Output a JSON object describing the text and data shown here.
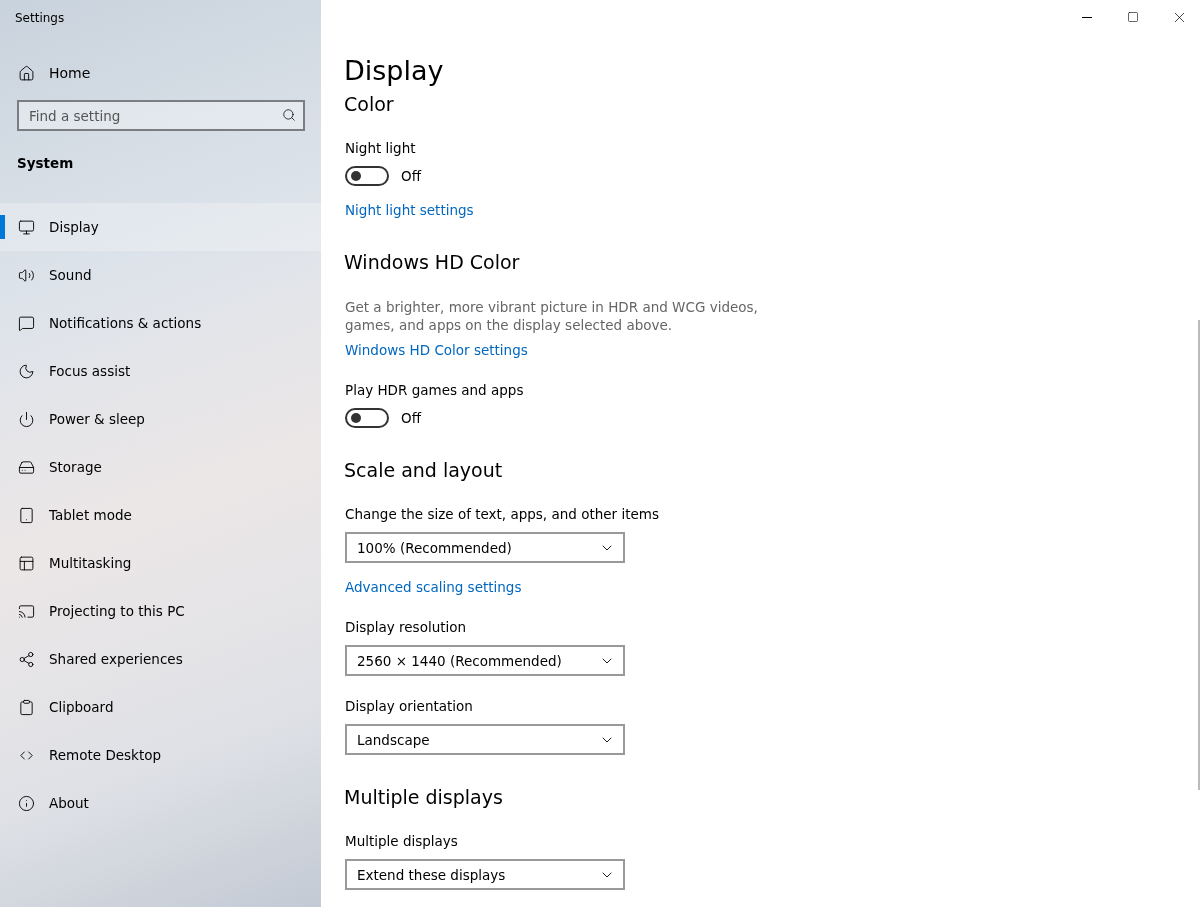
{
  "window": {
    "title": "Settings"
  },
  "sidebar": {
    "home": "Home",
    "search": {
      "placeholder": "Find a setting"
    },
    "group": "System",
    "items": [
      {
        "label": "Display",
        "selected": true
      },
      {
        "label": "Sound",
        "selected": false
      },
      {
        "label": "Notifications & actions",
        "selected": false
      },
      {
        "label": "Focus assist",
        "selected": false
      },
      {
        "label": "Power & sleep",
        "selected": false
      },
      {
        "label": "Storage",
        "selected": false
      },
      {
        "label": "Tablet mode",
        "selected": false
      },
      {
        "label": "Multitasking",
        "selected": false
      },
      {
        "label": "Projecting to this PC",
        "selected": false
      },
      {
        "label": "Shared experiences",
        "selected": false
      },
      {
        "label": "Clipboard",
        "selected": false
      },
      {
        "label": "Remote Desktop",
        "selected": false
      },
      {
        "label": "About",
        "selected": false
      }
    ]
  },
  "page_title": "Display",
  "sections": [
    {
      "heading": "Color",
      "items": [
        {
          "kind": "label",
          "text": "Night light"
        },
        {
          "kind": "toggle",
          "on": false,
          "text": "Off"
        },
        {
          "kind": "link",
          "text": "Night light settings"
        }
      ]
    },
    {
      "heading": "Windows HD Color",
      "items": [
        {
          "kind": "description",
          "text": "Get a brighter, more vibrant picture in HDR and WCG videos, games, and apps on the display selected above."
        },
        {
          "kind": "link",
          "text": "Windows HD Color settings"
        },
        {
          "kind": "label",
          "text": "Play HDR games and apps"
        },
        {
          "kind": "toggle",
          "on": false,
          "text": "Off"
        }
      ]
    },
    {
      "heading": "Scale and layout",
      "items": [
        {
          "kind": "label",
          "text": "Change the size of text, apps, and other items"
        },
        {
          "kind": "dropdown",
          "text": "100% (Recommended)"
        },
        {
          "kind": "link",
          "text": "Advanced scaling settings"
        },
        {
          "kind": "label",
          "text": "Display resolution"
        },
        {
          "kind": "dropdown",
          "text": "2560 × 1440 (Recommended)"
        },
        {
          "kind": "label",
          "text": "Display orientation"
        },
        {
          "kind": "dropdown",
          "text": "Landscape"
        }
      ]
    },
    {
      "heading": "Multiple displays",
      "items": [
        {
          "kind": "label",
          "text": "Multiple displays"
        },
        {
          "kind": "dropdown",
          "text": "Extend these displays"
        }
      ]
    }
  ]
}
